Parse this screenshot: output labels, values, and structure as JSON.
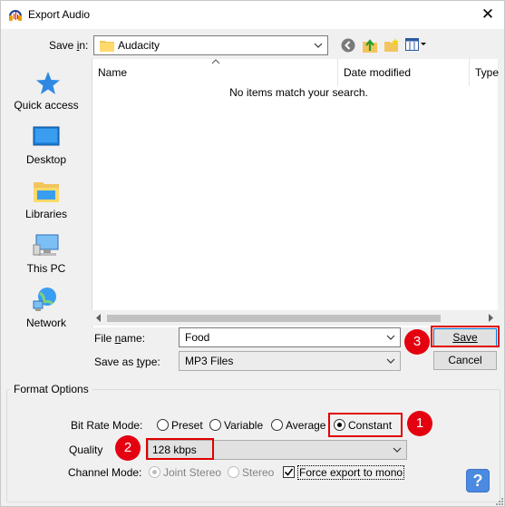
{
  "window": {
    "title": "Export Audio",
    "close": "✕"
  },
  "save_in": {
    "label": "Save in:",
    "value": "Audacity"
  },
  "places": [
    {
      "label": "Quick access",
      "icon": "quick-access-star-icon"
    },
    {
      "label": "Desktop",
      "icon": "desktop-icon"
    },
    {
      "label": "Libraries",
      "icon": "libraries-icon"
    },
    {
      "label": "This PC",
      "icon": "this-pc-icon"
    },
    {
      "label": "Network",
      "icon": "network-icon"
    }
  ],
  "file_list": {
    "columns": [
      "Name",
      "Date modified",
      "Type"
    ],
    "empty_message": "No items match your search."
  },
  "file_name": {
    "label": "File name:",
    "value": "Food"
  },
  "save_as_type": {
    "label": "Save as type:",
    "value": "MP3 Files"
  },
  "buttons": {
    "save": "Save",
    "cancel": "Cancel"
  },
  "format_options": {
    "title": "Format Options",
    "bit_rate_mode": {
      "label": "Bit Rate Mode:",
      "options": [
        "Preset",
        "Variable",
        "Average",
        "Constant"
      ],
      "selected": "Constant"
    },
    "quality": {
      "label": "Quality",
      "value": "128 kbps"
    },
    "channel_mode": {
      "label": "Channel Mode:",
      "options": [
        "Joint Stereo",
        "Stereo"
      ],
      "selected": "Joint Stereo",
      "force_mono_label": "Force export to mono",
      "force_mono_checked": true
    }
  },
  "markers": [
    "1",
    "2",
    "3"
  ],
  "help": "?",
  "colors": {
    "highlight": "#e00000",
    "accent": "#0078d7"
  }
}
